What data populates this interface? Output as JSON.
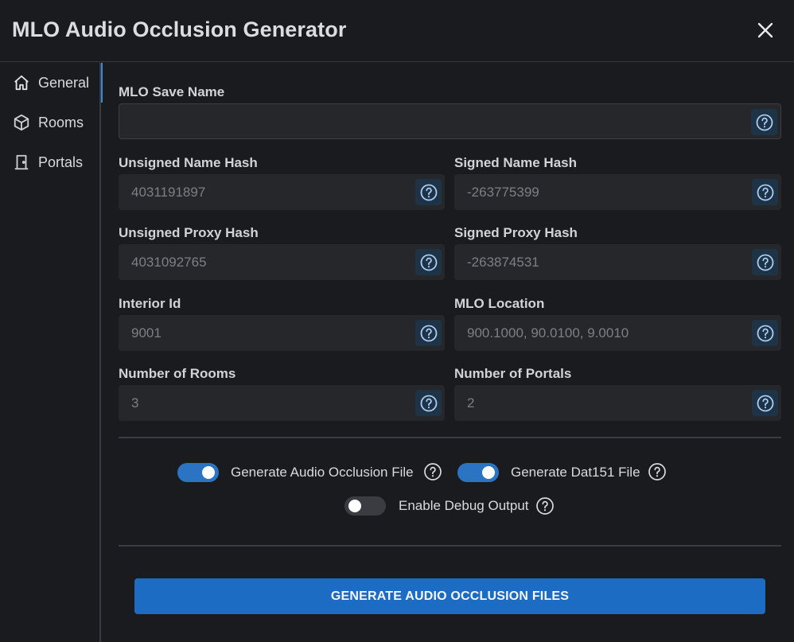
{
  "window": {
    "title": "MLO Audio Occlusion Generator"
  },
  "sidebar": {
    "items": [
      {
        "label": "General",
        "icon": "home-icon",
        "active": true
      },
      {
        "label": "Rooms",
        "icon": "cube-icon",
        "active": false
      },
      {
        "label": "Portals",
        "icon": "door-icon",
        "active": false
      }
    ]
  },
  "form": {
    "mlo_save_name": {
      "label": "MLO Save Name",
      "value": ""
    },
    "unsigned_name_hash": {
      "label": "Unsigned Name Hash",
      "value": "4031191897"
    },
    "signed_name_hash": {
      "label": "Signed Name Hash",
      "value": "-263775399"
    },
    "unsigned_proxy_hash": {
      "label": "Unsigned Proxy Hash",
      "value": "4031092765"
    },
    "signed_proxy_hash": {
      "label": "Signed Proxy Hash",
      "value": "-263874531"
    },
    "interior_id": {
      "label": "Interior Id",
      "value": "9001"
    },
    "mlo_location": {
      "label": "MLO Location",
      "value": "900.1000, 90.0100, 9.0010"
    },
    "number_of_rooms": {
      "label": "Number of Rooms",
      "value": "3"
    },
    "number_of_portals": {
      "label": "Number of Portals",
      "value": "2"
    }
  },
  "options": {
    "generate_audio_occlusion_file": {
      "label": "Generate Audio Occlusion File",
      "on": true
    },
    "generate_dat151_file": {
      "label": "Generate Dat151 File",
      "on": true
    },
    "enable_debug_output": {
      "label": "Enable Debug Output",
      "on": false
    }
  },
  "actions": {
    "generate_label": "GENERATE AUDIO OCCLUSION FILES"
  },
  "colors": {
    "accent": "#1c6cc4",
    "toggle_on": "#2b74c4",
    "background": "#1a1b1e",
    "field": "#25272b"
  }
}
